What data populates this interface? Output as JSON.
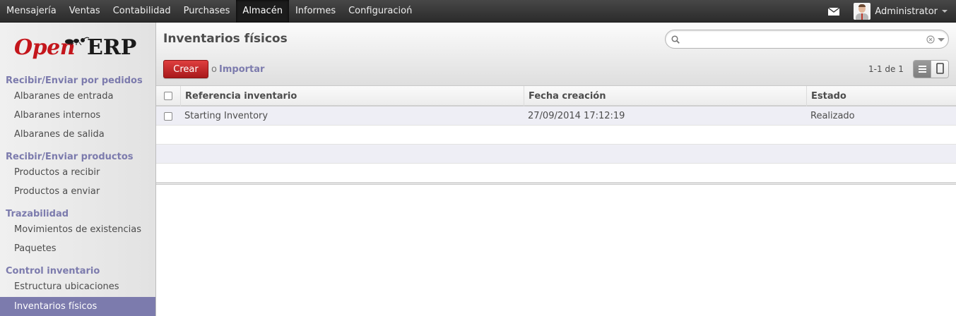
{
  "topbar": {
    "menu": [
      {
        "label": "Mensajería"
      },
      {
        "label": "Ventas"
      },
      {
        "label": "Contabilidad"
      },
      {
        "label": "Purchases"
      },
      {
        "label": "Almacén",
        "active": true
      },
      {
        "label": "Informes"
      },
      {
        "label": "Configuracioń"
      }
    ],
    "user_name": "Administrator"
  },
  "sidebar": {
    "logo": {
      "open": "Open",
      "erp": "ERP"
    },
    "sections": [
      {
        "title": "Recibir/Enviar por pedidos",
        "items": [
          "Albaranes de entrada",
          "Albaranes internos",
          "Albaranes de salida"
        ]
      },
      {
        "title": "Recibir/Enviar productos",
        "items": [
          "Productos a recibir",
          "Productos a enviar"
        ]
      },
      {
        "title": "Trazabilidad",
        "items": [
          "Movimientos de existencias",
          "Paquetes"
        ]
      },
      {
        "title": "Control inventario",
        "items": [
          "Estructura ubicaciones",
          "Inventarios físicos"
        ]
      }
    ],
    "active_item": "Inventarios físicos"
  },
  "header": {
    "title": "Inventarios físicos",
    "search_placeholder": "",
    "create_label": "Crear",
    "or_label": "o",
    "import_label": "Importar",
    "pager": "1-1 de 1"
  },
  "table": {
    "columns": [
      "Referencia inventario",
      "Fecha creación",
      "Estado"
    ],
    "rows": [
      {
        "reference": "Starting Inventory",
        "date": "27/09/2014 17:12:19",
        "state": "Realizado"
      }
    ]
  },
  "colors": {
    "accent": "#7c7bad",
    "create_button": "#c12a2a",
    "topbar": "#333333"
  }
}
